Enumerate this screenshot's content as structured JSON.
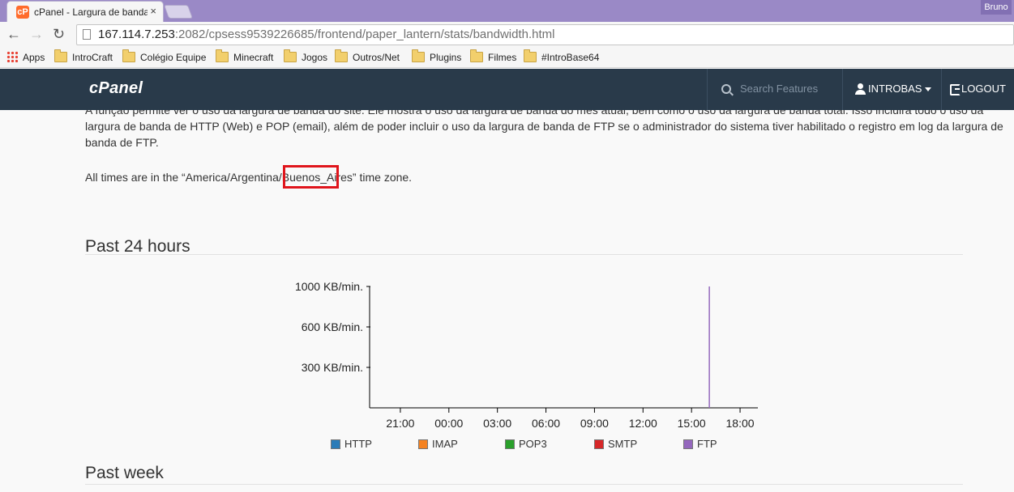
{
  "browser": {
    "tab_title": "cPanel - Largura de banda",
    "tab_close": "×",
    "favicon_text": "cP",
    "window_user": "Bruno",
    "url_host": "167.114.7.253",
    "url_rest": ":2082/cpsess9539226685/frontend/paper_lantern/stats/bandwidth.html",
    "nav_back": "←",
    "nav_forward": "→",
    "nav_reload": "↻"
  },
  "bookmarks": {
    "apps": "Apps",
    "items": [
      "IntroCraft",
      "Colégio Equipe",
      "Minecraft",
      "Jogos",
      "Outros/Net",
      "Plugins",
      "Filmes",
      "#IntroBase64"
    ]
  },
  "header": {
    "logo": "cPanel",
    "search_placeholder": "Search Features",
    "user": "INTROBAS",
    "logout": "LOGOUT"
  },
  "content": {
    "description": "A função permite ver o uso da largura de banda do site. Ele mostra o uso da largura de banda do mês atual, bem como o uso da largura de banda total. Isso incluirá todo o uso da largura de banda de HTTP (Web) e POP (email), além de poder incluir o uso da largura de banda de FTP se o administrador do sistema tiver habilitado o registro em log da largura de banda de FTP.",
    "timezone_note": "All times are in the “America/Argentina/Buenos_Aires” time zone.",
    "section1": "Past 24 hours",
    "section2": "Past week"
  },
  "colors": {
    "http": "#2b7cb8",
    "imap": "#f58220",
    "pop3": "#2aa02b",
    "smtp": "#d62728",
    "ftp": "#9467bd",
    "highlight": "#e0151c",
    "header_bg": "#293a4a"
  },
  "chart_data": {
    "type": "line",
    "title": "Past 24 hours",
    "xlabel": "",
    "ylabel": "",
    "y_ticks": [
      {
        "label": "300 KB/min.",
        "value": 300
      },
      {
        "label": "600 KB/min.",
        "value": 600
      },
      {
        "label": "1000 KB/min.",
        "value": 1000
      }
    ],
    "x_ticks": [
      "21:00",
      "00:00",
      "03:00",
      "06:00",
      "09:00",
      "12:00",
      "15:00",
      "18:00"
    ],
    "x_tick_hours": [
      21,
      24,
      27,
      30,
      33,
      36,
      39,
      42
    ],
    "xlim_hours": [
      19.1,
      43.1
    ],
    "ylim": [
      0,
      1000
    ],
    "y_scale": "nonlinear (tick spacing equal for 300, 600, 1000)",
    "legend_position": "bottom",
    "series": [
      {
        "name": "HTTP",
        "color": "#2b7cb8",
        "x": [],
        "values": []
      },
      {
        "name": "IMAP",
        "color": "#f58220",
        "x": [],
        "values": []
      },
      {
        "name": "POP3",
        "color": "#2aa02b",
        "x": [],
        "values": []
      },
      {
        "name": "SMTP",
        "color": "#d62728",
        "x": [],
        "values": []
      },
      {
        "name": "FTP",
        "color": "#9467bd",
        "x": [
          16.1,
          16.1
        ],
        "values": [
          0,
          1000
        ]
      }
    ]
  }
}
